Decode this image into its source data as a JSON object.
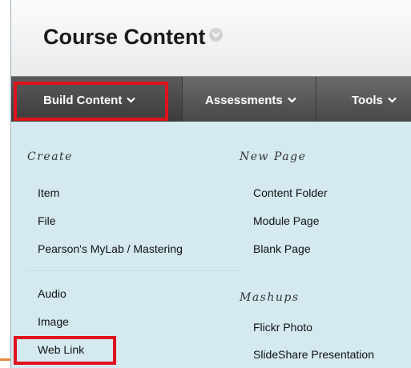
{
  "page": {
    "title": "Course Content"
  },
  "toolbar": {
    "build": "Build Content",
    "assessments": "Assessments",
    "tools": "Tools"
  },
  "menu": {
    "create": {
      "heading": "Create",
      "items": [
        "Item",
        "File",
        "Pearson's MyLab / Mastering",
        "Audio",
        "Image",
        "Web Link"
      ]
    },
    "new_page": {
      "heading": "New Page",
      "items": [
        "Content Folder",
        "Module Page",
        "Blank Page"
      ]
    },
    "mashups": {
      "heading": "Mashups",
      "items": [
        "Flickr Photo",
        "SlideShare Presentation"
      ]
    }
  },
  "colors": {
    "highlight": "#e0121d",
    "toolbar": "#4a4a4a",
    "menu_bg": "#d4eaf0"
  },
  "icons": {
    "title_menu": "chevron-down-circle-icon",
    "toolbar_dropdown": "chevron-down-icon"
  }
}
